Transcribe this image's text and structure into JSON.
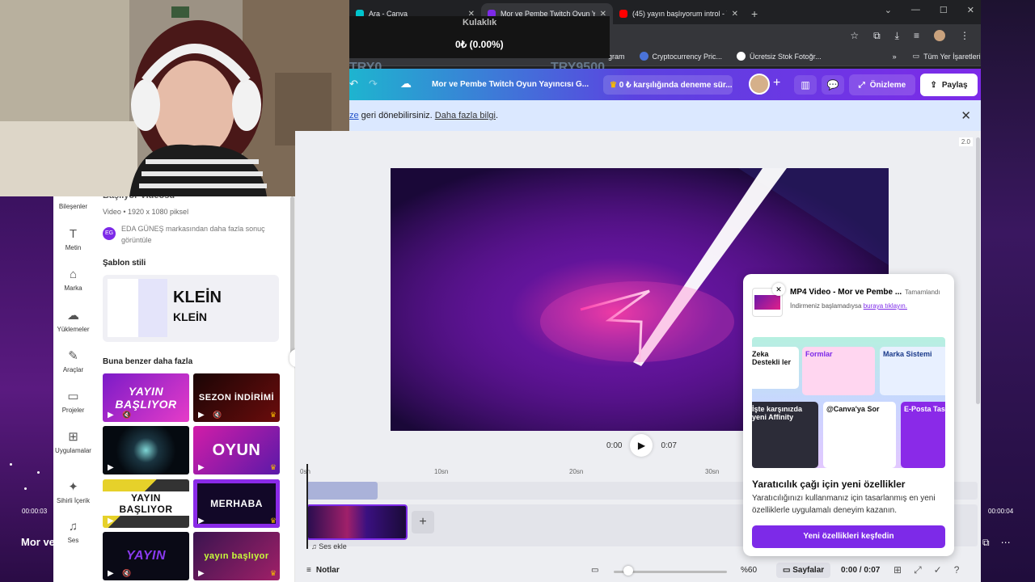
{
  "stream_overlay": {
    "label": "Kulaklık",
    "value": "0₺ (0.00%)",
    "ticker_left": "TRY0",
    "ticker_right": "TRY9500",
    "left_time": "00:00:03",
    "right_time": "00:00:04",
    "left_title": "Mor ve"
  },
  "browser": {
    "tabs": [
      {
        "title": "Ara - Canva",
        "color": "#00c4cc"
      },
      {
        "title": "Mor ve Pembe Twitch Oyun Yay",
        "color": "#7d2ae8"
      },
      {
        "title": "(45) yayın başlıyorum introl - Yo",
        "color": "#ff0000"
      }
    ],
    "bookmarks": [
      {
        "label": "gram"
      },
      {
        "label": "Cryptocurrency Pric..."
      },
      {
        "label": "Ücretsiz Stok Fotoğr..."
      },
      {
        "label": "Tüm Yer İşaretleri"
      }
    ]
  },
  "header": {
    "doc_title": "Mor ve Pembe Twitch Oyun Yayıncısı G...",
    "trial": "0 ₺ karşılığında deneme sür...",
    "preview": "Önizleme",
    "share": "Paylaş"
  },
  "notice": {
    "frag": "ze",
    "text": " geri dönebilirsiniz. ",
    "link": "Daha fazla bilgi",
    "end": "."
  },
  "leftnav": [
    {
      "label": "Bileşenler",
      "icon": "elements-icon"
    },
    {
      "label": "Metin",
      "icon": "text-icon"
    },
    {
      "label": "Marka",
      "icon": "brand-icon"
    },
    {
      "label": "Yüklemeler",
      "icon": "upload-icon"
    },
    {
      "label": "Araçlar",
      "icon": "tools-icon"
    },
    {
      "label": "Projeler",
      "icon": "folder-icon"
    },
    {
      "label": "Uygulamalar",
      "icon": "apps-icon"
    },
    {
      "label": "Sihirli İçerik",
      "icon": "magic-icon"
    },
    {
      "label": "Ses",
      "icon": "music-icon"
    }
  ],
  "panel": {
    "title": "Başlıyor Videosu",
    "meta": "Video • 1920 x 1080 piksel",
    "brand_initials": "EG",
    "brand_text": "EDA GÜNEŞ markasından daha fazla sonuç görüntüle",
    "style_heading": "Şablon stili",
    "style_font_1": "KLEİN",
    "style_font_2": "KLEİN",
    "more_heading": "Buna benzer daha fazla",
    "thumbs": [
      {
        "text": "YAYIN BAŞLIYOR"
      },
      {
        "text": "SEZON İNDİRİMİ"
      },
      {
        "text": ""
      },
      {
        "text": "OYUN"
      },
      {
        "text": "YAYIN BAŞLIYOR"
      },
      {
        "text": "MERHABA"
      },
      {
        "text": "YAYIN"
      },
      {
        "text": "yayın başlıyor"
      }
    ]
  },
  "canvas": {
    "zoom_tag": "2.0",
    "time_current": "0:00",
    "time_total": "0:07",
    "ticks": [
      "0sn",
      "10sn",
      "20sn",
      "30sn"
    ],
    "add_audio": "Ses ekle"
  },
  "bottombar": {
    "notes": "Notlar",
    "zoom": "%60",
    "pages": "Sayfalar",
    "time": "0:00 / 0:07"
  },
  "popup": {
    "title": "MP4 Video - Mor ve Pembe ...",
    "status": "Tamamlandı",
    "sub": "İndirmeniz başlamadıysa ",
    "sub_link": "buraya tıklayın.",
    "banner_cards": [
      "Zeka Destekli ler",
      "Formlar",
      "Marka Sistemi",
      "İşte karşınızda yeni Affinity",
      "@Canva'ya Sor",
      "E-Posta Tas"
    ],
    "heading": "Yaratıcılık çağı için yeni özellikler",
    "body": "Yaratıcılığınızı kullanmanız için tasarlanmış en yeni özelliklerle uygulamalı deneyim kazanın.",
    "cta": "Yeni özellikleri keşfedin"
  }
}
